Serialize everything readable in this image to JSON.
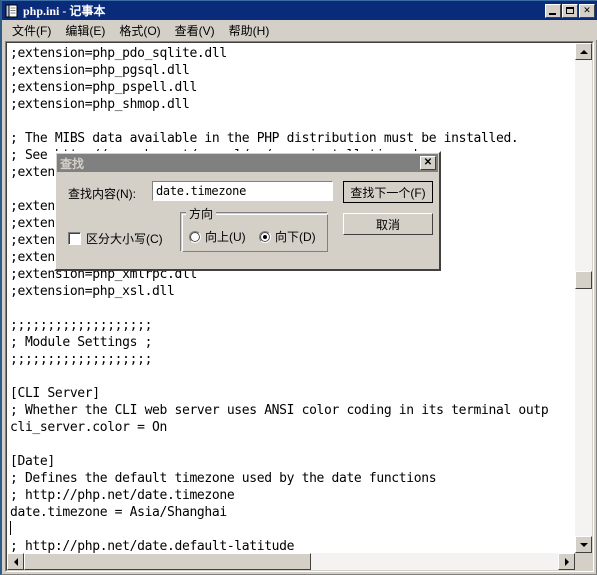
{
  "window": {
    "title": "php.ini - 记事本",
    "icon": "notepad-icon",
    "minimize_label": "",
    "maximize_label": "",
    "close_label": "✕"
  },
  "menu": {
    "items": [
      {
        "label": "文件(F)"
      },
      {
        "label": "编辑(E)"
      },
      {
        "label": "格式(O)"
      },
      {
        "label": "查看(V)"
      },
      {
        "label": "帮助(H)"
      }
    ]
  },
  "editor": {
    "lines": [
      ";extension=php_pdo_sqlite.dll",
      ";extension=php_pgsql.dll",
      ";extension=php_pspell.dll",
      ";extension=php_shmop.dll",
      "",
      "; The MIBS data available in the PHP distribution must be installed.",
      "; See http://www.php.net/manual/en/snmp.installation.php",
      ";extension=php_snmp.dll",
      "",
      ";extension=php_soap.dll",
      ";extension=php_sockets.dll",
      ";extension=php_sqlite3.dll",
      ";extension=php_tidy.dll",
      ";extension=php_xmlrpc.dll",
      ";extension=php_xsl.dll",
      "",
      ";;;;;;;;;;;;;;;;;;;",
      "; Module Settings ;",
      ";;;;;;;;;;;;;;;;;;;",
      "",
      "[CLI Server]",
      "; Whether the CLI web server uses ANSI color coding in its terminal outp",
      "cli_server.color = On",
      "",
      "[Date]",
      "; Defines the default timezone used by the date functions",
      "; http://php.net/date.timezone",
      "date.timezone = Asia/Shanghai",
      "",
      "; http://php.net/date.default-latitude"
    ],
    "caret_line_index": 28,
    "caret_column": 16
  },
  "scrollbars": {
    "vertical": {
      "up_arrow": "scroll-up-arrow",
      "down_arrow": "scroll-down-arrow"
    },
    "horizontal": {
      "left_arrow": "scroll-left-arrow",
      "right_arrow": "scroll-right-arrow"
    }
  },
  "find_dialog": {
    "title": "查找",
    "close_label": "✕",
    "find_what_label": "查找内容(N):",
    "find_what_value": "date.timezone",
    "find_what_placeholder": "",
    "find_next_label": "查找下一个(F)",
    "cancel_label": "取消",
    "match_case_label": "区分大小写(C)",
    "match_case_checked": false,
    "direction_legend": "方向",
    "direction_up_label": "向上(U)",
    "direction_down_label": "向下(D)",
    "direction_selected": "down"
  },
  "colors": {
    "title_bar": "#0a2a7a",
    "dialog_title_bar": "#808080",
    "face": "#d4d0c8",
    "text_bg": "#ffffff",
    "text_fg": "#000000"
  }
}
